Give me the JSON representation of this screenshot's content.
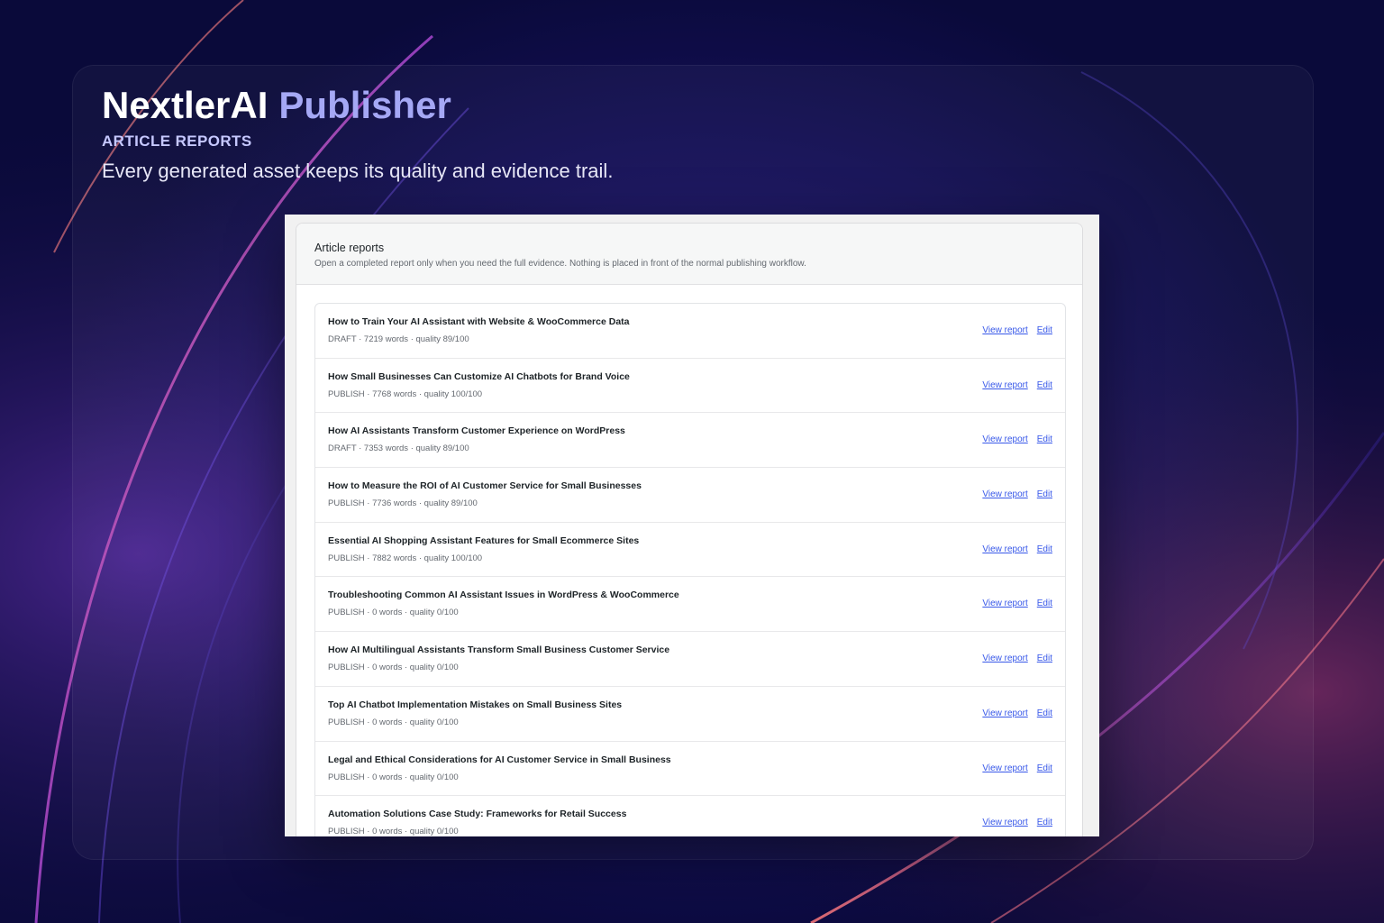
{
  "hero": {
    "brand": "NextlerAI",
    "product": "Publisher",
    "eyebrow": "ARTICLE REPORTS",
    "tagline": "Every generated asset keeps its quality and evidence trail."
  },
  "card": {
    "title": "Article reports",
    "description": "Open a completed report only when you need the full evidence. Nothing is placed in front of the normal publishing workflow."
  },
  "actions": {
    "view_label": "View report",
    "edit_label": "Edit"
  },
  "articles": [
    {
      "title": "How to Train Your AI Assistant with Website & WooCommerce Data",
      "meta": "DRAFT · 7219 words · quality 89/100"
    },
    {
      "title": "How Small Businesses Can Customize AI Chatbots for Brand Voice",
      "meta": "PUBLISH · 7768 words · quality 100/100"
    },
    {
      "title": "How AI Assistants Transform Customer Experience on WordPress",
      "meta": "DRAFT · 7353 words · quality 89/100"
    },
    {
      "title": "How to Measure the ROI of AI Customer Service for Small Businesses",
      "meta": "PUBLISH · 7736 words · quality 89/100"
    },
    {
      "title": "Essential AI Shopping Assistant Features for Small Ecommerce Sites",
      "meta": "PUBLISH · 7882 words · quality 100/100"
    },
    {
      "title": "Troubleshooting Common AI Assistant Issues in WordPress & WooCommerce",
      "meta": "PUBLISH · 0 words · quality 0/100"
    },
    {
      "title": "How AI Multilingual Assistants Transform Small Business Customer Service",
      "meta": "PUBLISH · 0 words · quality 0/100"
    },
    {
      "title": "Top AI Chatbot Implementation Mistakes on Small Business Sites",
      "meta": "PUBLISH · 0 words · quality 0/100"
    },
    {
      "title": "Legal and Ethical Considerations for AI Customer Service in Small Business",
      "meta": "PUBLISH · 0 words · quality 0/100"
    },
    {
      "title": "Automation Solutions Case Study: Frameworks for Retail Success",
      "meta": "PUBLISH · 0 words · quality 0/100"
    }
  ],
  "colors": {
    "accent": "#a5a8f5",
    "link": "#3858e9",
    "background": "#0a0a3a"
  }
}
